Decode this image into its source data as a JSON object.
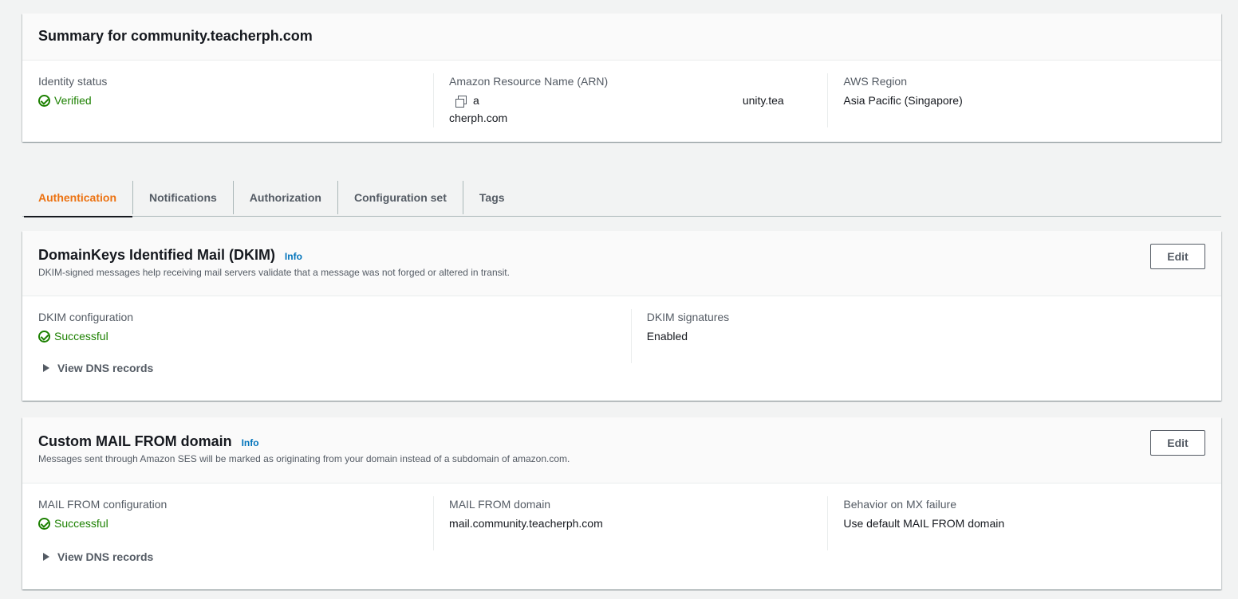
{
  "summary": {
    "title": "Summary for community.teacherph.com",
    "identity_status_label": "Identity status",
    "identity_status_value": "Verified",
    "arn_label": "Amazon Resource Name (ARN)",
    "arn_visible_start": "a",
    "arn_visible_end": "unity.tea",
    "arn_line2": "cherph.com",
    "region_label": "AWS Region",
    "region_value": "Asia Pacific (Singapore)"
  },
  "tabs": [
    {
      "label": "Authentication"
    },
    {
      "label": "Notifications"
    },
    {
      "label": "Authorization"
    },
    {
      "label": "Configuration set"
    },
    {
      "label": "Tags"
    }
  ],
  "dkim": {
    "title": "DomainKeys Identified Mail (DKIM)",
    "info": "Info",
    "description": "DKIM-signed messages help receiving mail servers validate that a message was not forged or altered in transit.",
    "edit_label": "Edit",
    "config_label": "DKIM configuration",
    "config_value": "Successful",
    "signatures_label": "DKIM signatures",
    "signatures_value": "Enabled",
    "view_dns": "View DNS records"
  },
  "mailfrom": {
    "title": "Custom MAIL FROM domain",
    "info": "Info",
    "description": "Messages sent through Amazon SES will be marked as originating from your domain instead of a subdomain of amazon.com.",
    "edit_label": "Edit",
    "config_label": "MAIL FROM configuration",
    "config_value": "Successful",
    "domain_label": "MAIL FROM domain",
    "domain_value": "mail.community.teacherph.com",
    "mx_label": "Behavior on MX failure",
    "mx_value": "Use default MAIL FROM domain",
    "view_dns": "View DNS records"
  },
  "colors": {
    "success": "#1d8102",
    "link": "#0073bb",
    "active_tab": "#ec7211"
  }
}
